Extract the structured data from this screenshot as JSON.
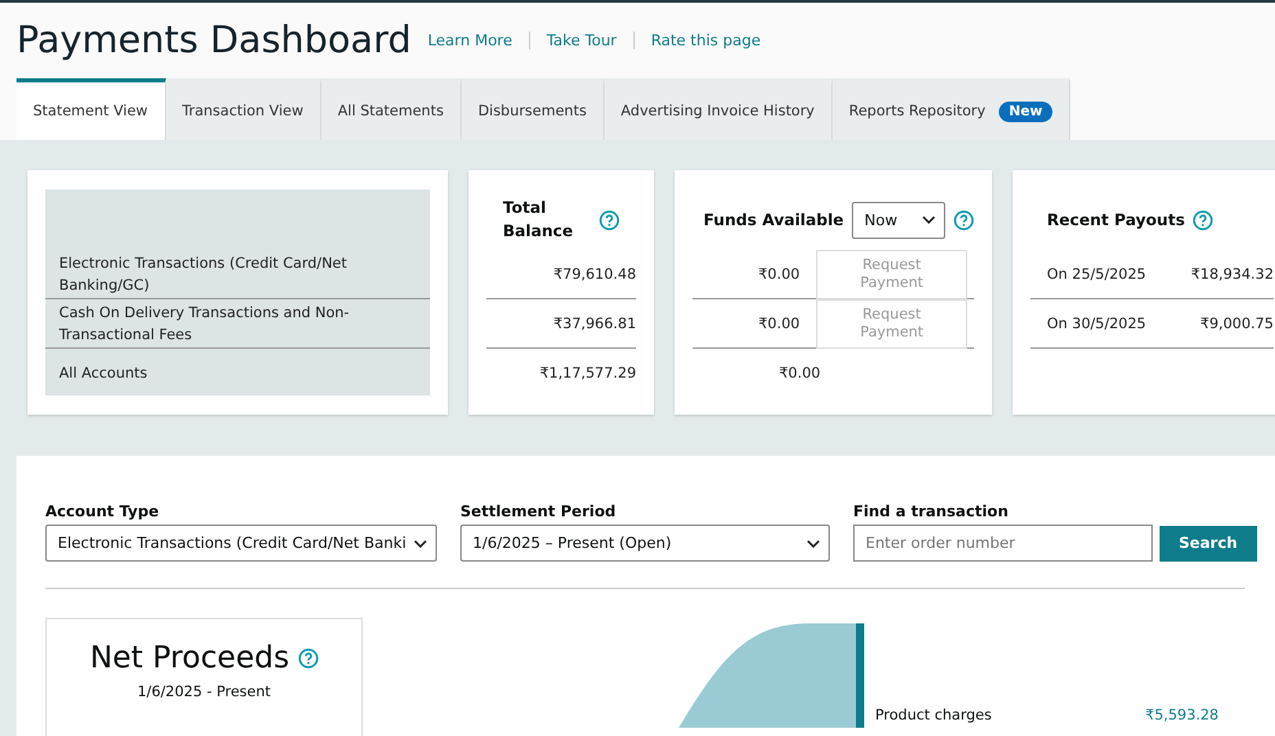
{
  "header": {
    "title": "Payments Dashboard",
    "links": [
      "Learn More",
      "Take Tour",
      "Rate this page"
    ]
  },
  "tabs": [
    {
      "label": "Statement View",
      "selected": true
    },
    {
      "label": "Transaction View",
      "selected": false
    },
    {
      "label": "All Statements",
      "selected": false
    },
    {
      "label": "Disbursements",
      "selected": false
    },
    {
      "label": "Advertising Invoice History",
      "selected": false
    },
    {
      "label": "Reports Repository",
      "selected": false,
      "badge": "New"
    }
  ],
  "accounts": {
    "rows": [
      "Electronic Transactions (Credit Card/Net Banking/GC)",
      "Cash On Delivery Transactions and Non-Transactional Fees",
      "All Accounts"
    ]
  },
  "total_balance": {
    "title": "Total Balance",
    "values": [
      "₹79,610.48",
      "₹37,966.81",
      "₹1,17,577.29"
    ]
  },
  "funds_available": {
    "title": "Funds Available",
    "period": "Now",
    "values": [
      "₹0.00",
      "₹0.00",
      "₹0.00"
    ],
    "request_buttons": [
      {
        "label": "Request Payment",
        "disabled": true
      },
      {
        "label": "Request Payment",
        "disabled": true
      }
    ]
  },
  "recent_payouts": {
    "title": "Recent Payouts",
    "rows": [
      {
        "date": "On 25/5/2025",
        "amount": "₹18,934.32"
      },
      {
        "date": "On 30/5/2025",
        "amount": "₹9,000.75"
      }
    ]
  },
  "filters": {
    "account_type": {
      "label": "Account Type",
      "value": "Electronic Transactions (Credit Card/Net Banki"
    },
    "settlement_period": {
      "label": "Settlement Period",
      "value": "1/6/2025 – Present (Open)"
    },
    "find": {
      "label": "Find a transaction",
      "placeholder": "Enter order number",
      "button": "Search"
    }
  },
  "net_proceeds": {
    "title": "Net Proceeds",
    "period": "1/6/2025 - Present"
  },
  "breakdown": [
    {
      "label": "Product charges",
      "amount": "₹5,593.28"
    }
  ]
}
